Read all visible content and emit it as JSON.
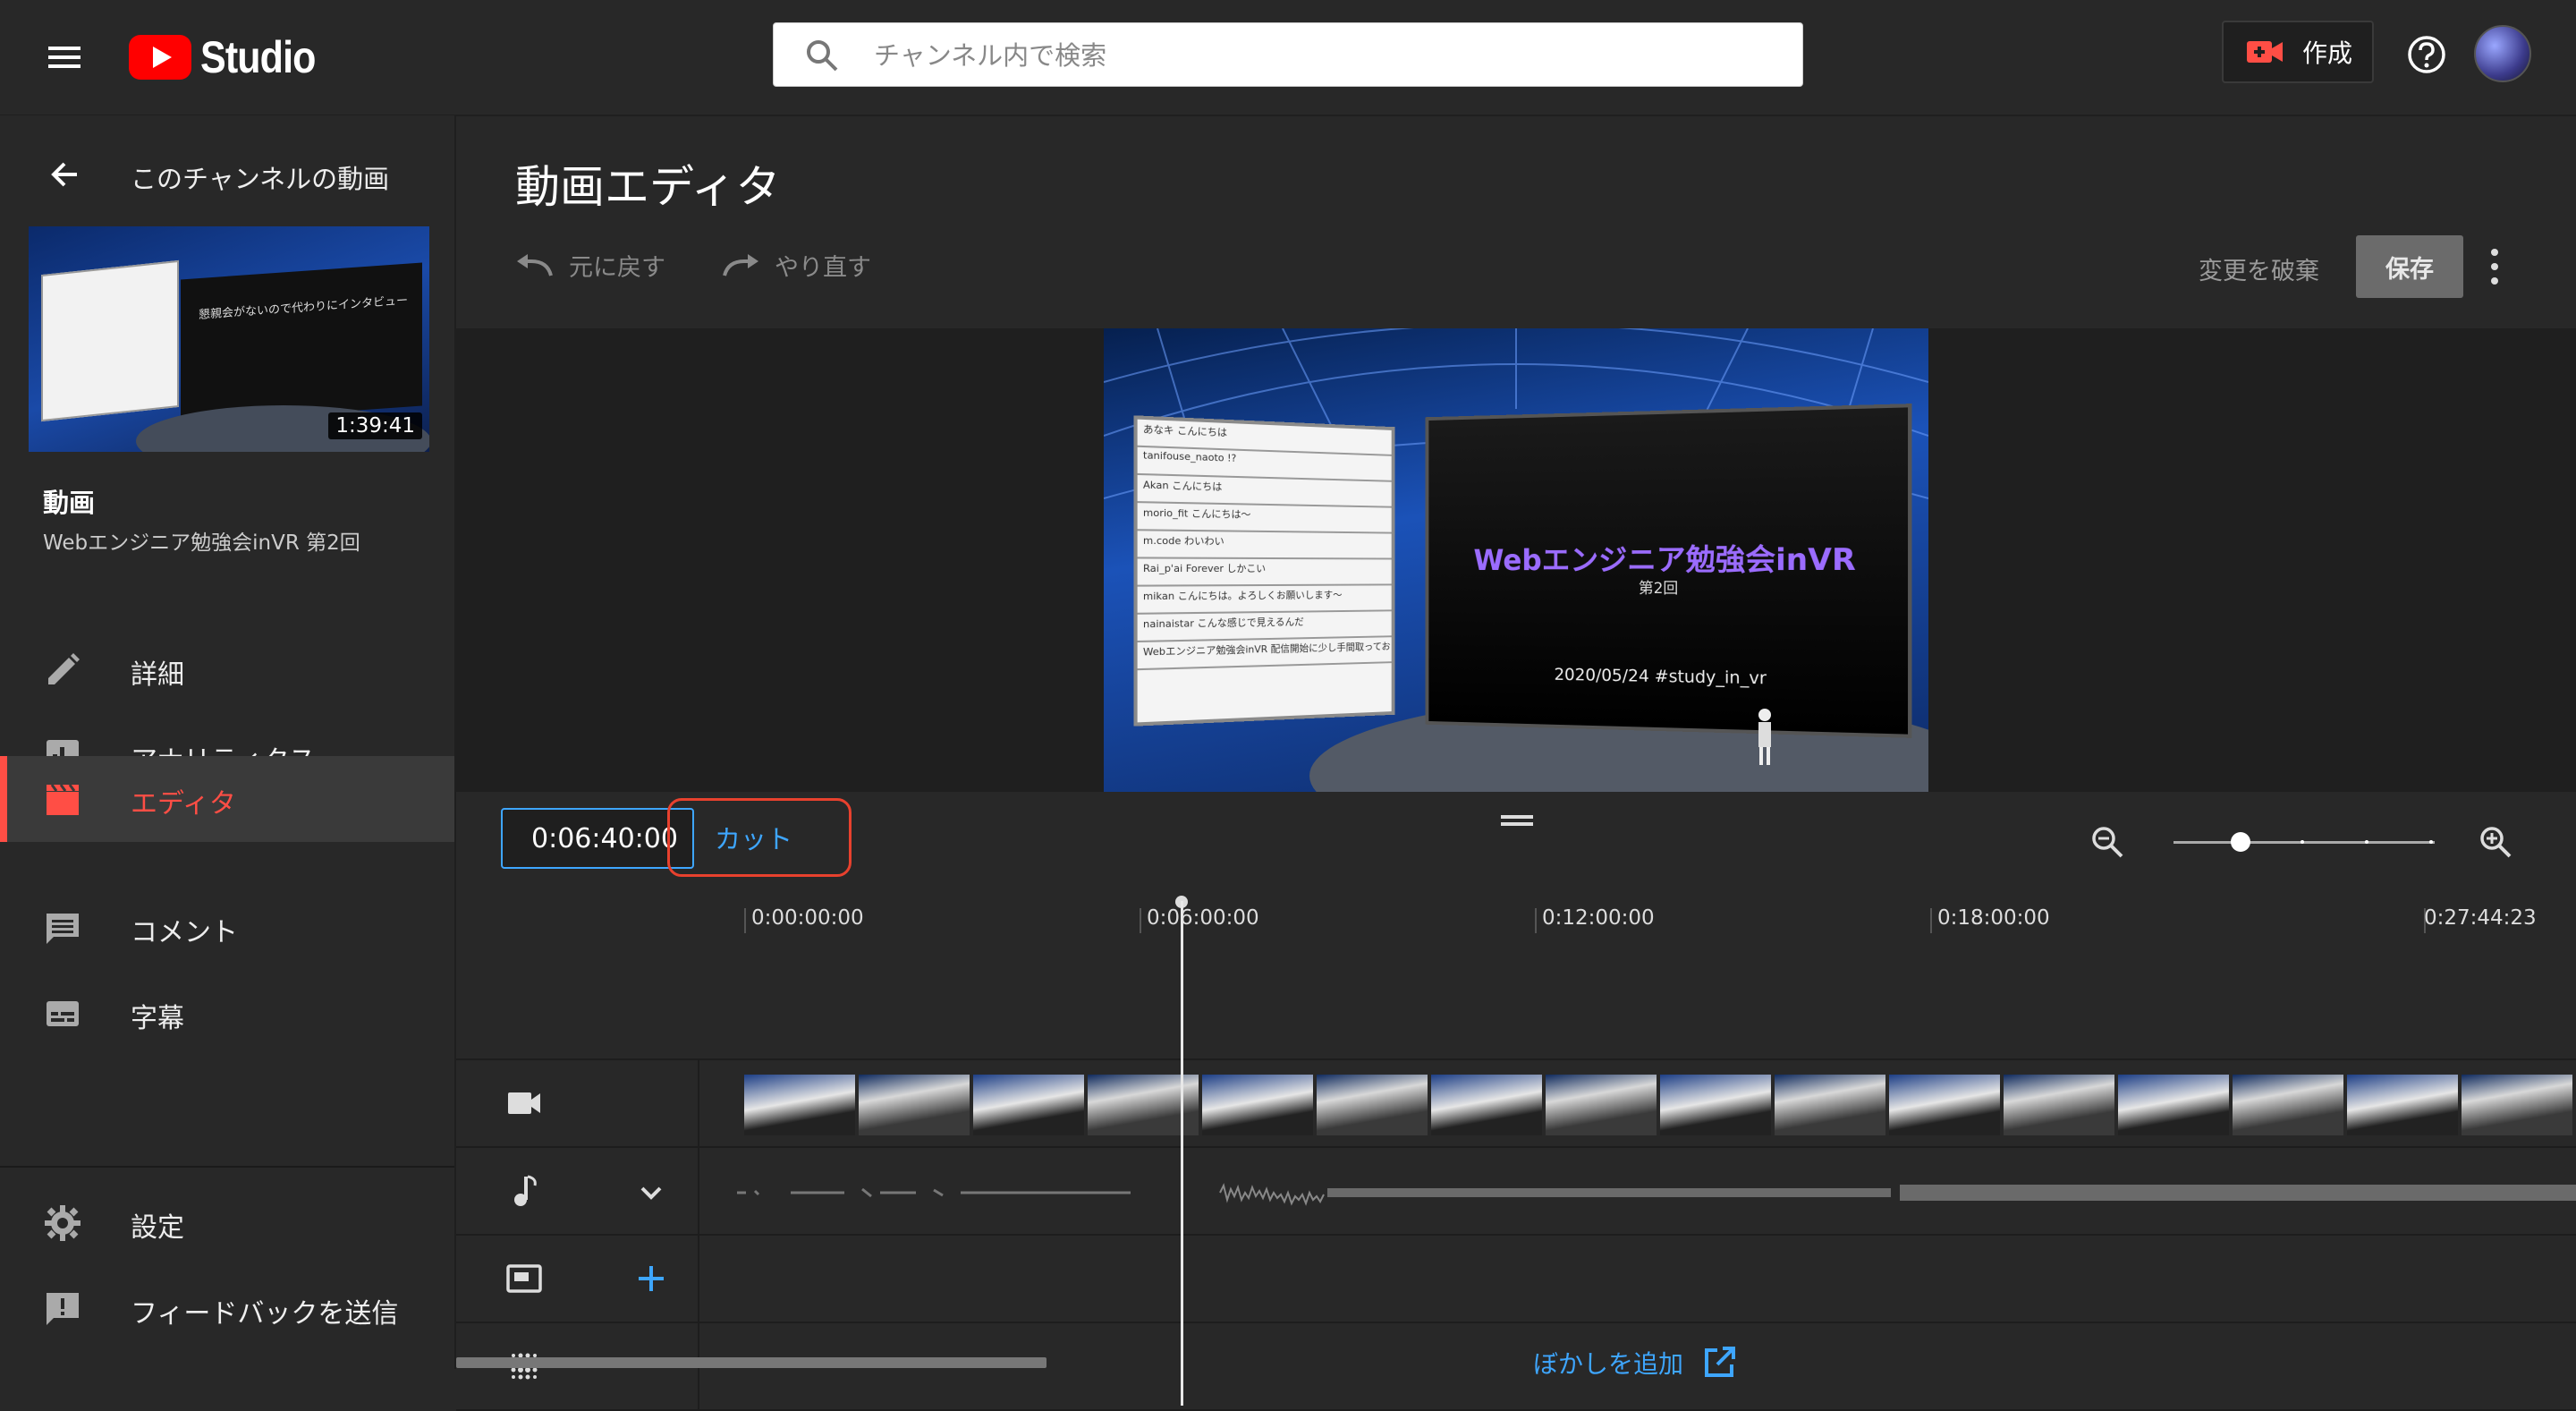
{
  "app": {
    "logo_text": "Studio",
    "brand_color": "#ff0000",
    "accent_color": "#3ea6ff",
    "active_color": "#ff4e45"
  },
  "header": {
    "search_placeholder": "チャンネル内で検索",
    "create_label": "作成"
  },
  "sidebar": {
    "back_label": "このチャンネルの動画",
    "thumbnail_duration": "1:39:41",
    "thumbnail_text": "懇親会がないので代わりにインタビュー",
    "section_title": "動画",
    "video_title": "Webエンジニア勉強会inVR 第2回",
    "items": [
      {
        "label": "詳細",
        "icon": "pencil-icon"
      },
      {
        "label": "アナリティクス",
        "icon": "analytics-icon"
      },
      {
        "label": "エディタ",
        "icon": "clapperboard-icon",
        "active": true
      },
      {
        "label": "コメント",
        "icon": "comment-icon"
      },
      {
        "label": "字幕",
        "icon": "subtitles-icon"
      }
    ],
    "footer_items": [
      {
        "label": "設定",
        "icon": "gear-icon"
      },
      {
        "label": "フィードバックを送信",
        "icon": "feedback-icon"
      }
    ]
  },
  "editor": {
    "title": "動画エディタ",
    "undo_label": "元に戻す",
    "redo_label": "やり直す",
    "discard_label": "変更を破棄",
    "save_label": "保存",
    "preview": {
      "slide_title": "Webエンジニア勉強会inVR",
      "slide_sub": "第2回",
      "slide_date": "2020/05/24 #study_in_vr",
      "chat_lines": [
        "あなキ こんにちは",
        "tanifouse_naoto !?",
        "Akan こんにちは",
        "morio_fit こんにちは～",
        "m.code わいわい",
        "Rai_p'ai Forever しかこい",
        "mikan こんにちは。よろしくお願いします～",
        "nainaistar こんな感じで見えるんだ",
        "Webエンジニア勉強会inVR 配信開始に少し手間取っております……"
      ]
    },
    "time_value": "0:06:40:00",
    "cut_label": "カット",
    "zoom_level": 0.2,
    "ruler": [
      "0:00:00:00",
      "0:06:00:00",
      "0:12:00:00",
      "0:18:00:00",
      "0:27:44:23"
    ],
    "add_blur_label": "ぼかしを追加"
  }
}
